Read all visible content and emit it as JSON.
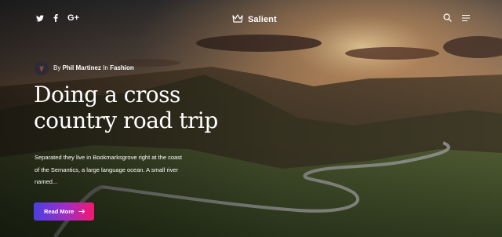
{
  "header": {
    "social": [
      {
        "name": "twitter-icon"
      },
      {
        "name": "facebook-icon"
      },
      {
        "name": "google-plus-icon",
        "label": "G+"
      }
    ],
    "logo_text": "Salient"
  },
  "post": {
    "meta_prefix": "By",
    "author": "Phil Martinez",
    "meta_in": "In",
    "category": "Fashion",
    "title": "Doing a cross country road trip",
    "excerpt": "Separated they live in Bookmarksgrove right at the coast of the Semantics, a large language ocean. A small river named...",
    "read_more_label": "Read More"
  },
  "colors": {
    "button_gradient_start": "#4b3fe0",
    "button_gradient_end": "#f01a6f",
    "text": "#ffffff"
  }
}
